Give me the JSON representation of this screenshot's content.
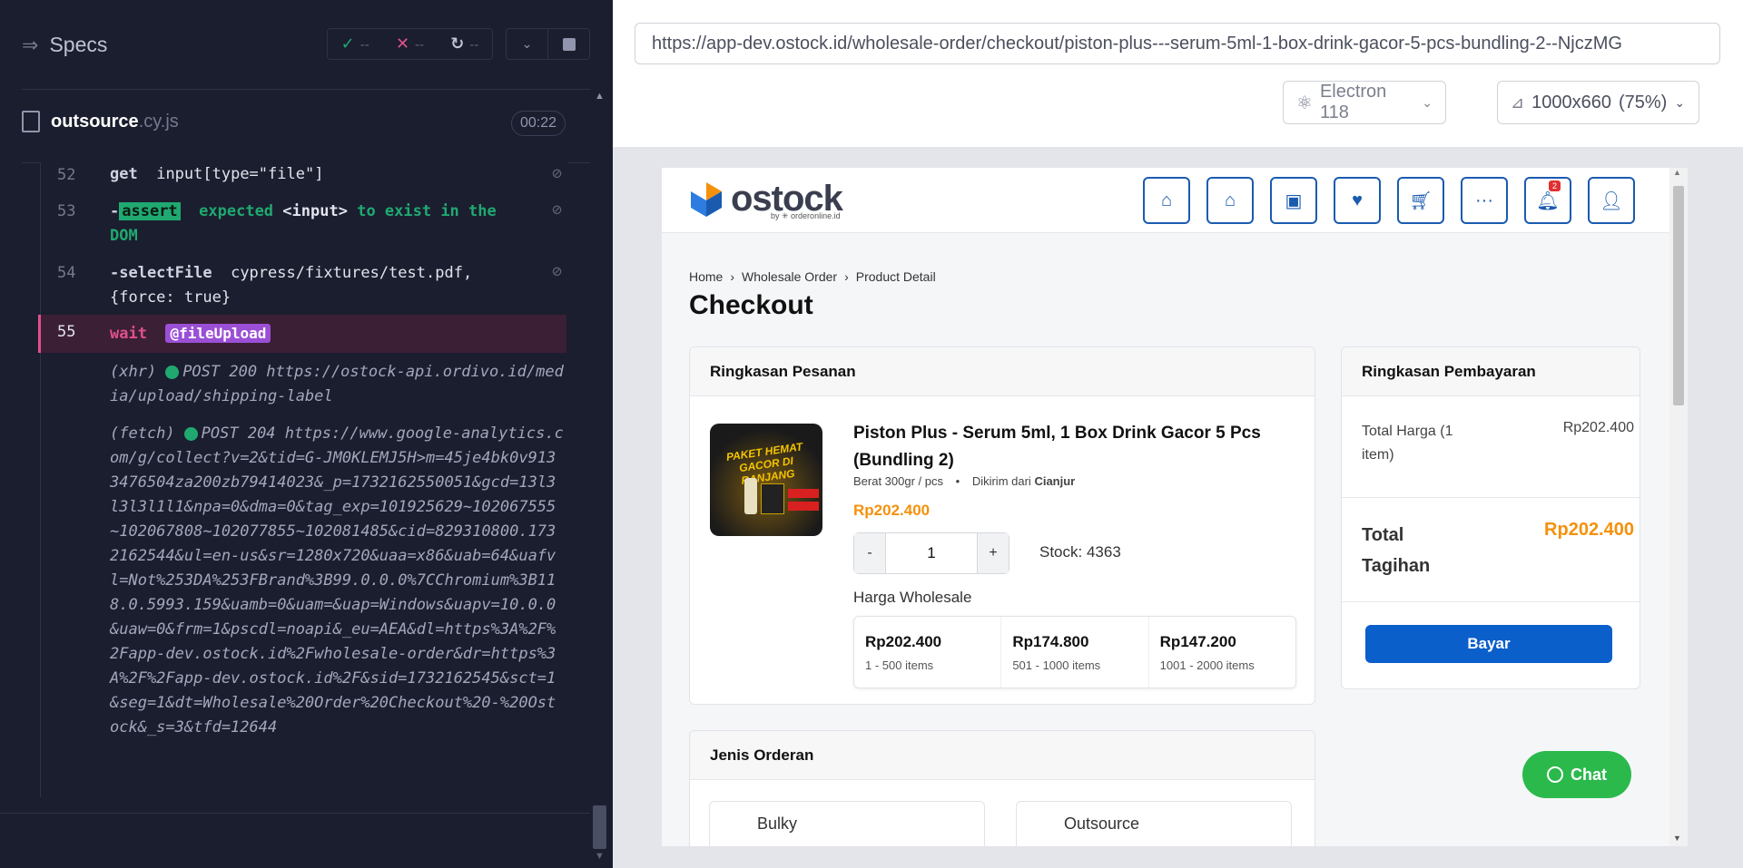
{
  "runner": {
    "specs_label": "Specs",
    "stats": {
      "passed": "--",
      "failed": "--",
      "pending": "--"
    },
    "file_name": "outsource",
    "file_ext": ".cy.js",
    "timer": "00:22",
    "commands": [
      {
        "num": "52",
        "name": "get",
        "arg": "input[type=\"file\"]"
      },
      {
        "num": "53",
        "name": "assert",
        "msg_pre": "expected",
        "msg_el": "<input>",
        "msg_post": "to exist in the DOM"
      },
      {
        "num": "54",
        "name": "-selectFile",
        "arg": "cypress/fixtures/test.pdf, {force: true}"
      },
      {
        "num": "55",
        "name": "wait",
        "arg": "@fileUpload"
      }
    ],
    "xhr_log": [
      {
        "kind": "(xhr)",
        "text": "POST 200 https://ostock-api.ordivo.id/media/upload/shipping-label"
      },
      {
        "kind": "(fetch)",
        "text": "POST 204 https://www.google-analytics.com/g/collect?v=2&tid=G-JM0KLEMJ5H>m=45je4bk0v9133476504za200zb79414023&_p=1732162550051&gcd=13l3l3l3l1l1&npa=0&dma=0&tag_exp=101925629~102067555~102067808~102077855~102081485&cid=829310800.1732162544&ul=en-us&sr=1280x720&uaa=x86&uab=64&uafvl=Not%253DA%253FBrand%3B99.0.0.0%7CChromium%3B118.0.5993.159&uamb=0&uam=&uap=Windows&uapv=10.0.0&uaw=0&frm=1&pscdl=noapi&_eu=AEA&dl=https%3A%2F%2Fapp-dev.ostock.id%2Fwholesale-order&dr=https%3A%2F%2Fapp-dev.ostock.id%2F&sid=1732162545&sct=1&seg=1&dt=Wholesale%20Order%20Checkout%20-%20Ostock&_s=3&tfd=12644"
      }
    ]
  },
  "browser": {
    "url": "https://app-dev.ostock.id/wholesale-order/checkout/piston-plus---serum-5ml-1-box-drink-gacor-5-pcs-bundling-2--NjczMG",
    "engine": "Electron 118",
    "viewport": "1000x660",
    "zoom": "(75%)"
  },
  "app": {
    "logo": "ostock",
    "logo_by": "by ✳ orderonline.id",
    "notif_count": "2",
    "breadcrumb": [
      "Home",
      "Wholesale Order",
      "Product Detail"
    ],
    "page_title": "Checkout",
    "order_summary": {
      "heading": "Ringkasan Pesanan",
      "image_text": "PAKET HEMAT GACOR DI RANJANG",
      "product_name": "Piston Plus - Serum 5ml, 1 Box Drink Gacor 5 Pcs (Bundling 2)",
      "weight": "Berat 300gr / pcs",
      "ship_from_label": "Dikirim dari",
      "ship_from": "Cianjur",
      "price": "Rp202.400",
      "qty_minus": "-",
      "qty": "1",
      "qty_plus": "+",
      "stock": "Stock: 4363",
      "wholesale_label": "Harga Wholesale",
      "tiers": [
        {
          "price": "Rp202.400",
          "range": "1 - 500 items"
        },
        {
          "price": "Rp174.800",
          "range": "501 - 1000 items"
        },
        {
          "price": "Rp147.200",
          "range": "1001 - 2000 items"
        }
      ]
    },
    "payment_summary": {
      "heading": "Ringkasan Pembayaran",
      "total_price_label": "Total Harga (1 item)",
      "total_price": "Rp202.400",
      "total_bill_label": "Total Tagihan",
      "total_bill": "Rp202.400",
      "pay_button": "Bayar"
    },
    "order_type": {
      "heading": "Jenis Orderan",
      "options": [
        "Bulky",
        "Outsource"
      ]
    },
    "chat_button": "Chat",
    "colors": {
      "primary": "#0b5fcb",
      "price": "#f4910b",
      "chat": "#2bb94c"
    }
  }
}
